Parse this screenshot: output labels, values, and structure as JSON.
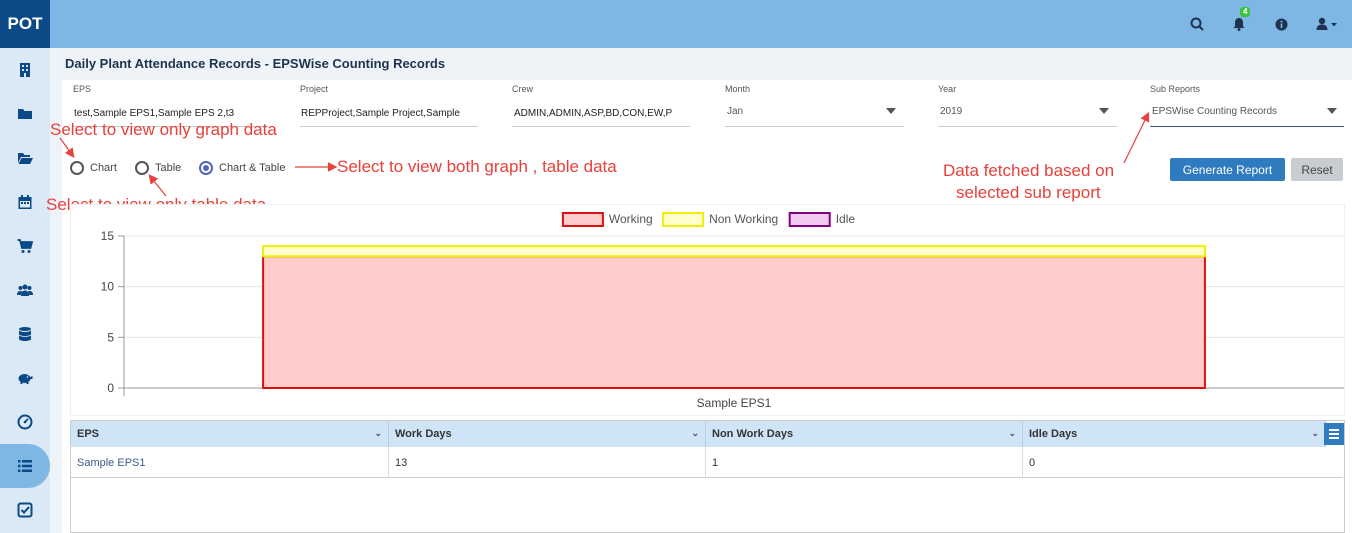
{
  "app": {
    "logo": "POT"
  },
  "topbar": {
    "notification_count": "4"
  },
  "page": {
    "title": "Daily Plant Attendance Records - EPSWise Counting Records"
  },
  "filters": {
    "eps": {
      "label": "EPS",
      "value": "test,Sample EPS1,Sample EPS 2,t3"
    },
    "project": {
      "label": "Project",
      "value": "REPProject,Sample Project,Sample"
    },
    "crew": {
      "label": "Crew",
      "value": "ADMIN,ADMIN,ASP,BD,CON,EW,P"
    },
    "month": {
      "label": "Month",
      "value": "Jan"
    },
    "year": {
      "label": "Year",
      "value": "2019"
    },
    "sub_reports": {
      "label": "Sub Reports",
      "value": "EPSWise Counting Records"
    }
  },
  "view_options": {
    "chart": "Chart",
    "table": "Table",
    "chart_table": "Chart & Table",
    "selected": "chart_table"
  },
  "buttons": {
    "generate": "Generate Report",
    "reset": "Reset"
  },
  "annotations": {
    "graph_only": "Select to view only graph data",
    "table_only": "Select to view only table data",
    "both": "Select to view both graph , table data",
    "sub_report_1": "Data fetched based on",
    "sub_report_2": "selected sub report"
  },
  "chart_data": {
    "type": "bar",
    "stacked": true,
    "categories": [
      "Sample EPS1"
    ],
    "series": [
      {
        "name": "Working",
        "values": [
          13
        ],
        "fill": "#ffcccc",
        "stroke": "#e01010"
      },
      {
        "name": "Non Working",
        "values": [
          1
        ],
        "fill": "#ffffcc",
        "stroke": "#f0f000"
      },
      {
        "name": "Idle",
        "values": [
          0
        ],
        "fill": "#f0c8f0",
        "stroke": "#800080"
      }
    ],
    "ylim": [
      0,
      15
    ],
    "yticks": [
      0,
      5,
      10,
      15
    ],
    "grid": true,
    "legend": "top-center"
  },
  "table": {
    "columns": [
      "EPS",
      "Work Days",
      "Non Work Days",
      "Idle Days"
    ],
    "rows": [
      [
        "Sample EPS1",
        "13",
        "1",
        "0"
      ]
    ]
  },
  "colors": {
    "accent": "#2f7bbf",
    "topbar": "#7eb7e4",
    "logo_bg": "#0b4a86",
    "annotation": "#e8403b"
  }
}
